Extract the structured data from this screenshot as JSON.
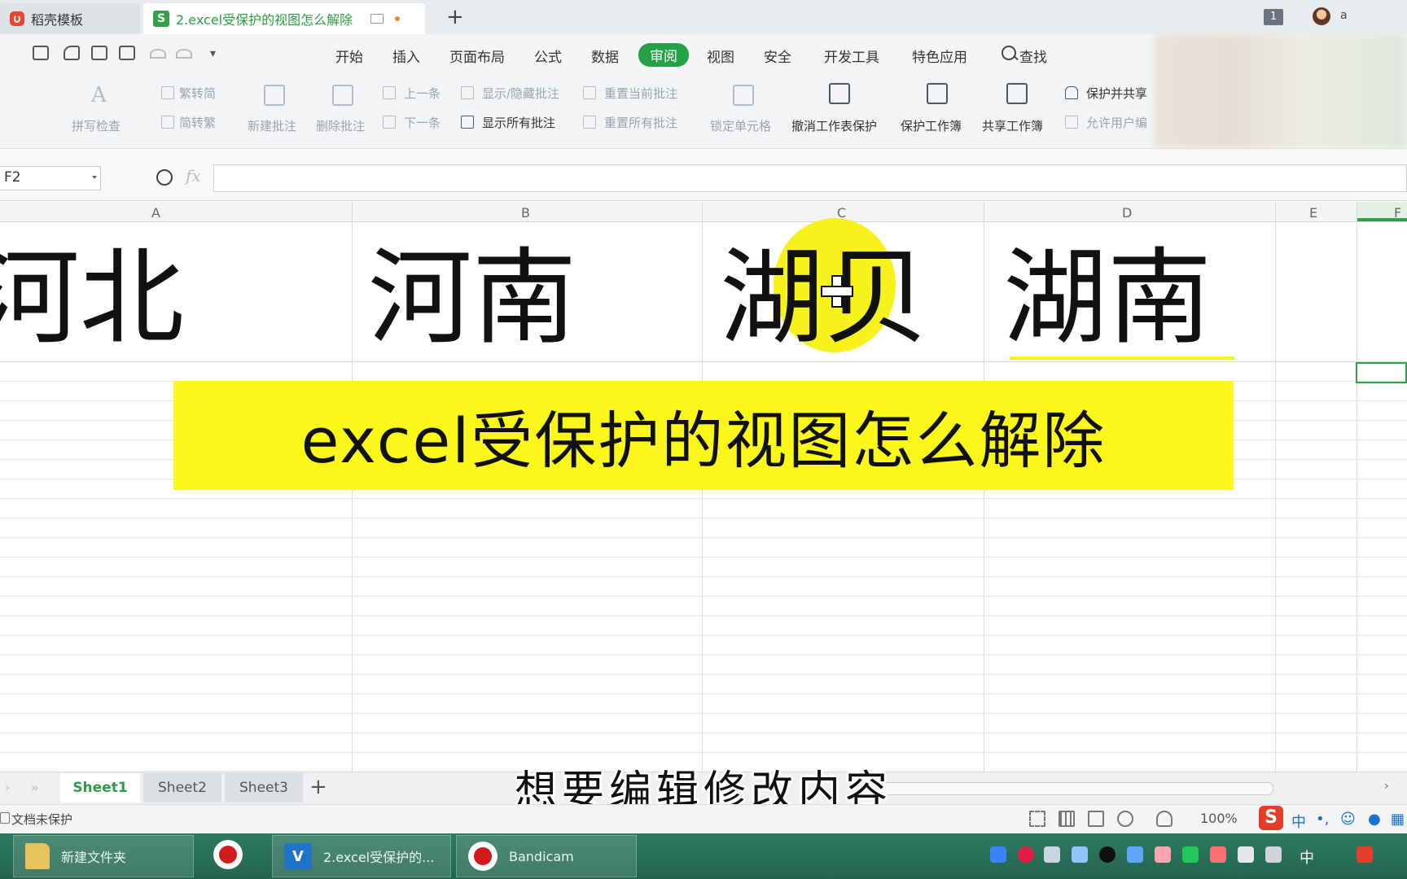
{
  "tabs": [
    {
      "label": "稻壳模板"
    },
    {
      "label": "2.excel受保护的视图怎么解除"
    }
  ],
  "titlebar": {
    "window_badge": "1",
    "user_initial": "a"
  },
  "menu": {
    "items": [
      "开始",
      "插入",
      "页面布局",
      "公式",
      "数据",
      "审阅",
      "视图",
      "安全",
      "开发工具",
      "特色应用"
    ],
    "search_label": "查找",
    "active": "审阅",
    "accent_color": "#22a146"
  },
  "ribbon": {
    "spellcheck": "拼写检查",
    "trad_to_simp": "繁转简",
    "simp_to_trad": "简转繁",
    "new_comment": "新建批注",
    "delete_comment": "删除批注",
    "prev_comment": "上一条",
    "next_comment": "下一条",
    "show_hide_comment": "显示/隐藏批注",
    "show_all_comments": "显示所有批注",
    "reset_current_comment": "重置当前批注",
    "reset_all_comments": "重置所有批注",
    "lock_cell": "锁定单元格",
    "unprotect_sheet": "撤消工作表保护",
    "protect_workbook": "保护工作簿",
    "share_workbook": "共享工作簿",
    "protect_and_share": "保护并共享",
    "allow_user_edit": "允许用户编"
  },
  "formula_bar": {
    "name_box": "F2",
    "fx_label": "fx",
    "formula": ""
  },
  "grid": {
    "columns": [
      "A",
      "B",
      "C",
      "D",
      "E",
      "F"
    ],
    "row1": [
      "河北",
      "河南",
      "湖贝",
      "湖南"
    ],
    "active_cell": "F2"
  },
  "overlay": {
    "title": "excel受保护的视图怎么解除",
    "subtitle": "想要编辑修改内容",
    "banner_color": "#fcf71a"
  },
  "sheets": [
    "Sheet1",
    "Sheet2",
    "Sheet3"
  ],
  "active_sheet": "Sheet1",
  "status": {
    "protection": "文档未保护",
    "zoom": "100%"
  },
  "ime": {
    "logo": "S",
    "lang": "中"
  },
  "taskbar": {
    "items": [
      "新建文件夹",
      "2.excel受保护的...",
      "Bandicam"
    ],
    "tray_lang": "中"
  }
}
